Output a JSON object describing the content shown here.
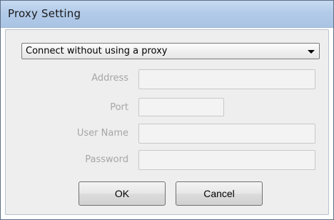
{
  "window": {
    "title": "Proxy Setting"
  },
  "proxy_mode": {
    "selected": "Connect without using a proxy"
  },
  "fields": {
    "address_label": "Address",
    "address_value": "",
    "port_label": "Port",
    "port_value": "",
    "username_label": "User Name",
    "username_value": "",
    "password_label": "Password",
    "password_value": ""
  },
  "buttons": {
    "ok_label": "OK",
    "cancel_label": "Cancel"
  },
  "colors": {
    "title_bar": "#b3cbe9",
    "disabled_text": "#a6a6a6",
    "client_background": "#eeeeee"
  },
  "icons": {
    "dropdown": "chevron-down-icon"
  }
}
